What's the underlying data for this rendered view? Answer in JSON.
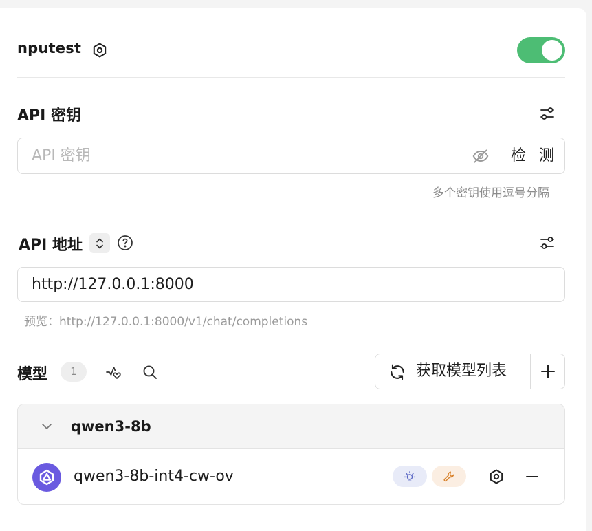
{
  "provider": {
    "name": "nputest",
    "enabled": true,
    "toggle_color": "#4dbd74"
  },
  "api_key": {
    "title": "API 密钥",
    "placeholder": "API 密钥",
    "check_label": "检 测",
    "hint": "多个密钥使用逗号分隔"
  },
  "api_host": {
    "title": "API 地址",
    "value": "http://127.0.0.1:8000",
    "preview": "预览：http://127.0.0.1:8000/v1/chat/completions"
  },
  "models": {
    "title": "模型",
    "count": "1",
    "fetch_label": "获取模型列表",
    "groups": [
      {
        "name": "qwen3-8b",
        "items": [
          {
            "name": "qwen3-8b-int4-cw-ov",
            "tags": [
              "reasoning-icon",
              "tool-icon"
            ]
          }
        ]
      }
    ]
  },
  "colors": {
    "accent_green": "#4dbd74",
    "logo_purple": "#6a5ae0",
    "reason_tag_bg": "#e8ebf8",
    "tool_tag_bg": "#fbeee2"
  }
}
